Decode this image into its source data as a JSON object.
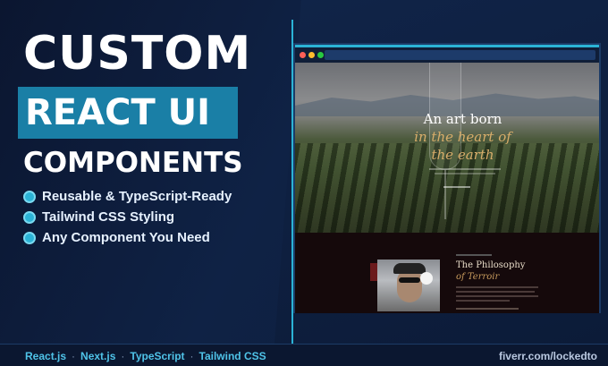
{
  "headline": {
    "line1": "CUSTOM",
    "line2": "REACT UI",
    "line3": "COMPONENTS"
  },
  "features": [
    "Reusable & TypeScript-Ready",
    "Tailwind CSS Styling",
    "Any Component You Need"
  ],
  "preview": {
    "hero_line1": "An art born",
    "hero_line2": "in the heart of",
    "hero_line3": "the earth",
    "section_title": "The Philosophy",
    "section_subtitle": "of Terroir"
  },
  "footer": {
    "stack": [
      "React.js",
      "Next.js",
      "TypeScript",
      "Tailwind CSS"
    ],
    "url": "fiverr.com/lockedto"
  },
  "colors": {
    "accent": "#2bb3d6",
    "highlight_box": "#1a7fa6",
    "background": "#0c1a33",
    "gold_text": "#d8ad6a"
  },
  "icons": {
    "feature_bullet": "globe-icon"
  }
}
